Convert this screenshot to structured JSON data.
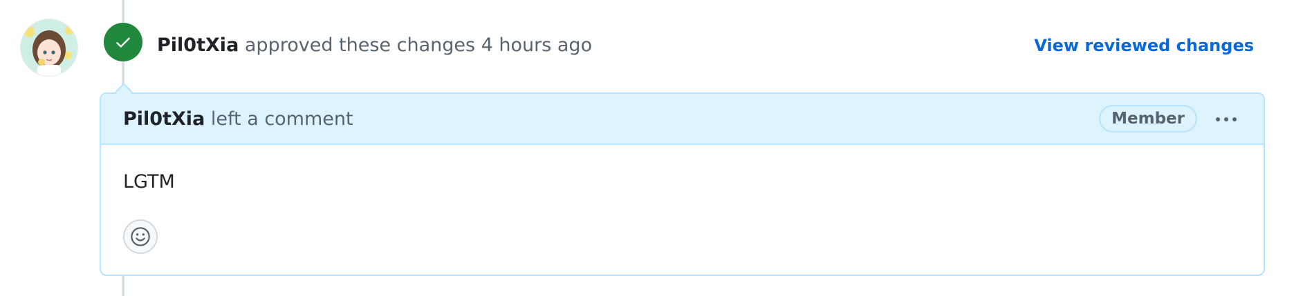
{
  "review_event": {
    "author": "Pil0tXia",
    "action_text": " approved these changes ",
    "timestamp": "4 hours ago",
    "view_changes_label": "View reviewed changes",
    "status_color": "#1f883d",
    "status_icon": "check-icon"
  },
  "comment": {
    "author": "Pil0tXia",
    "action_text": " left a comment",
    "role_badge": "Member",
    "body": "LGTM",
    "more_options_icon": "kebab-horizontal-icon",
    "reaction_icon": "smiley-icon"
  },
  "colors": {
    "accent_link": "#0969da",
    "header_bg": "#ddf4ff",
    "header_border": "#b6e3ff",
    "approved_green": "#1f883d"
  }
}
